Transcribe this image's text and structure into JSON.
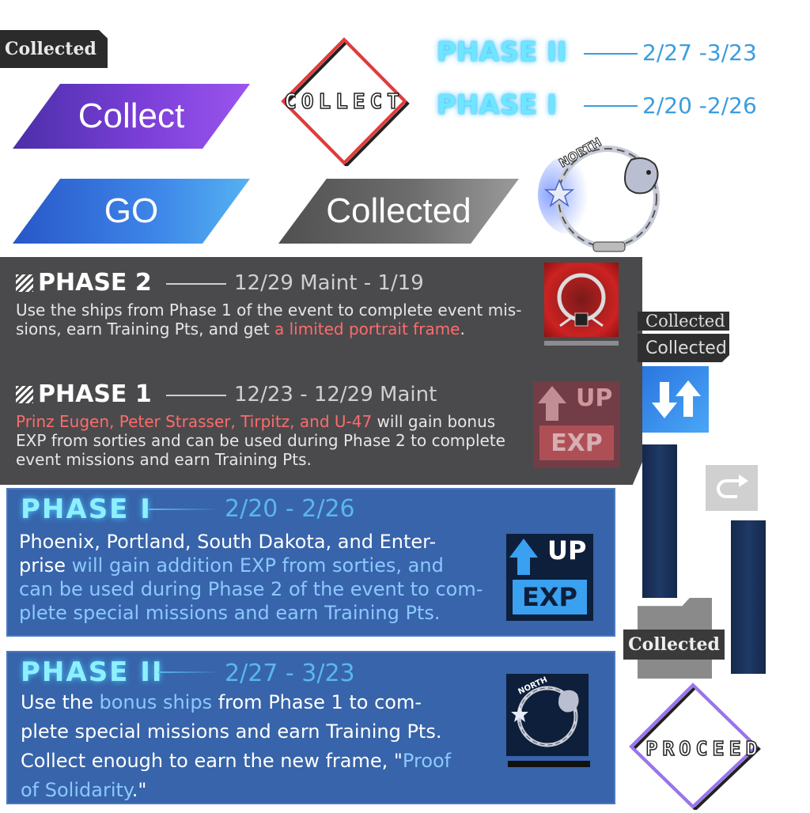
{
  "tags": {
    "collected_top_left": "Collected",
    "collected_small_1": "Collected",
    "collected_small_2": "Collected",
    "collected_mid_right": "Collected"
  },
  "buttons": {
    "collect_label": "Collect",
    "go_label": "GO",
    "collected_label": "Collected"
  },
  "diamonds": {
    "collect_word": "COLLECT",
    "proceed_word": "PROCEED"
  },
  "phase_legend": [
    {
      "label": "PHASE  II",
      "date": "2/27 -3/23"
    },
    {
      "label": "PHASE  I",
      "date": "2/20 -2/26"
    }
  ],
  "emblem": {
    "text": "NORTH"
  },
  "dark_panel": {
    "phase2": {
      "title": "PHASE 2",
      "date": "12/29 Maint - 1/19",
      "body_a": "Use the ships from Phase 1 of the event to complete event mis-",
      "body_b": "sions, earn Training Pts, and get ",
      "body_highlight": "a limited portrait frame",
      "body_end": "."
    },
    "phase1": {
      "title": "PHASE 1",
      "date": "12/23 - 12/29 Maint",
      "body_highlight": "Prinz Eugen, Peter Strasser, Tirpitz, and U-47",
      "body_a": " will gain bonus",
      "body_b": "EXP from sorties and can be used during Phase 2 to complete",
      "body_c": "event missions and earn Training Pts."
    },
    "exp_up": "UP",
    "exp_label": "EXP"
  },
  "blue_panel_1": {
    "title": "PHASE  I",
    "date": "2/20 - 2/26",
    "line1": "Phoenix, Portland, South Dakota, and Enter-",
    "line2_a": "prise",
    "line2_b": " will gain addition EXP from sorties, and",
    "line3": "can be used during Phase 2 of the event to com-",
    "line4": "plete special missions and earn Training Pts.",
    "exp_up": "UP",
    "exp_label": "EXP"
  },
  "blue_panel_2": {
    "title": "PHASE  II",
    "date": "2/27 - 3/23",
    "line1_a": "Use the ",
    "line1_highlight": "bonus ships",
    "line1_b": " from Phase 1 to com-",
    "line2": "plete special missions and earn Training Pts.",
    "line3_a": "Collect enough to earn the new frame, \"",
    "line3_highlight": "Proof",
    "line4_highlight": "of Solidarity",
    "line4_end": ".\""
  },
  "colors": {
    "purple": "#7b3fd8",
    "blue": "#3d86e8",
    "gray": "#6c6c6c",
    "dark_panel": "#4a4a4c",
    "blue_panel": "#3764aa",
    "red_text": "#ff6b6b",
    "cyan_title": "#8ef0ff"
  }
}
